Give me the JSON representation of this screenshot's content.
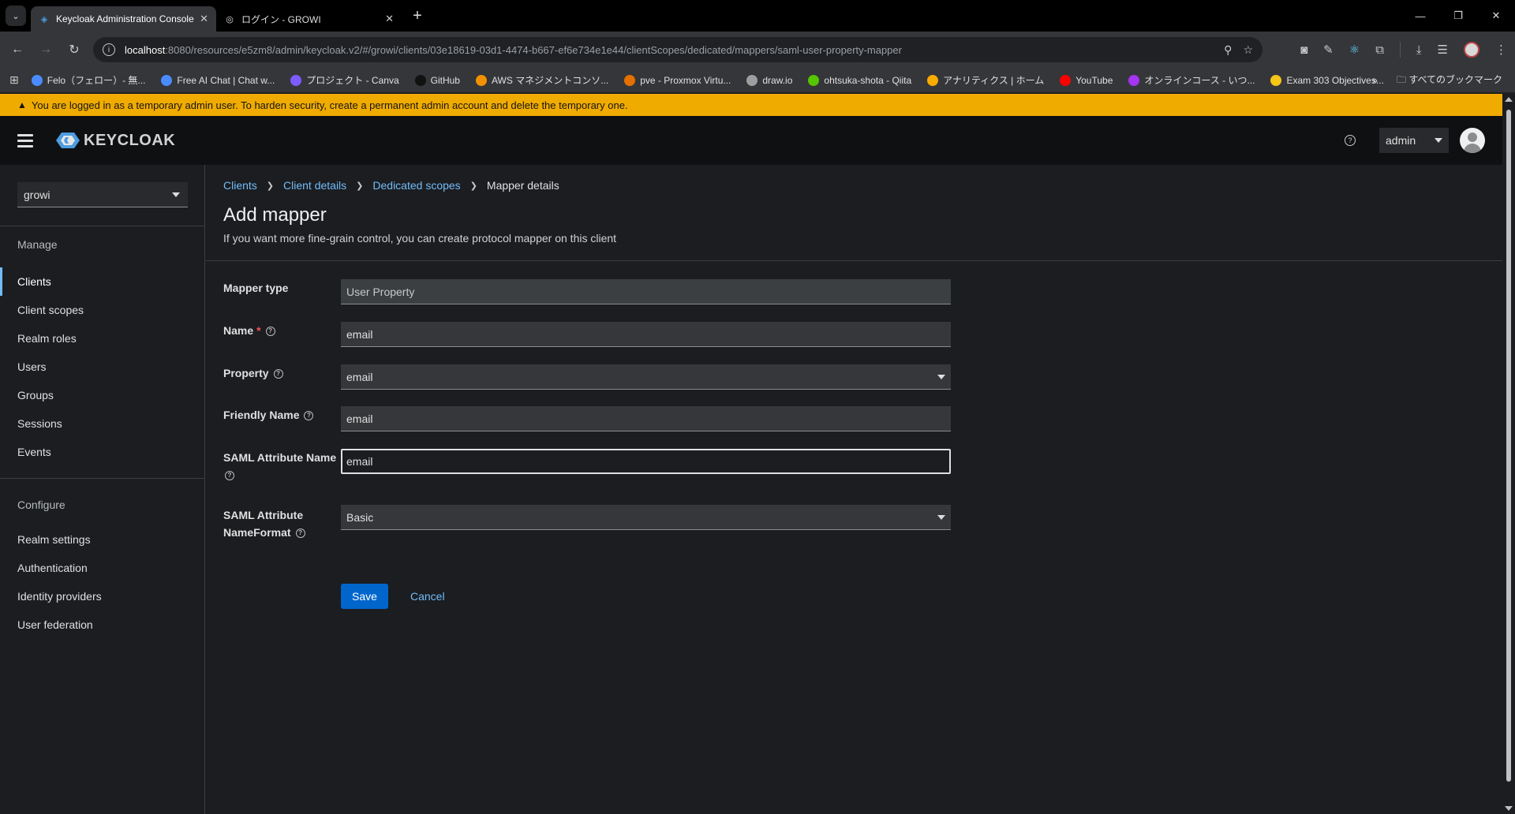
{
  "browser": {
    "tabs": [
      {
        "title": "Keycloak Administration Console",
        "icon": "keycloak-icon",
        "active": true
      },
      {
        "title": "ログイン - GROWI",
        "icon": "globe-icon",
        "active": false
      }
    ],
    "url_host": "localhost",
    "url_rest": ":8080/resources/e5zm8/admin/keycloak.v2/#/growi/clients/03e18619-03d1-4474-b667-ef6e734e1e44/clientScopes/dedicated/mappers/saml-user-property-mapper",
    "bookmarks": [
      {
        "label": "Felo（フェロー）- 無...",
        "color": "#4a8cff"
      },
      {
        "label": "Free AI Chat | Chat w...",
        "color": "#4a8cff"
      },
      {
        "label": "プロジェクト - Canva",
        "color": "#7d5cff"
      },
      {
        "label": "GitHub",
        "color": "#111111"
      },
      {
        "label": "AWS マネジメントコンソ...",
        "color": "#f29100"
      },
      {
        "label": "pve - Proxmox Virtu...",
        "color": "#e57000"
      },
      {
        "label": "draw.io",
        "color": "#9e9e9e"
      },
      {
        "label": "ohtsuka-shota - Qiita",
        "color": "#55c500"
      },
      {
        "label": "アナリティクス | ホーム",
        "color": "#f9ab00"
      },
      {
        "label": "YouTube",
        "color": "#ff0000"
      },
      {
        "label": "オンラインコース - いつ...",
        "color": "#a435f0"
      },
      {
        "label": "Exam 303 Objectives...",
        "color": "#f5c518"
      }
    ],
    "all_bookmarks_label": "すべてのブックマーク"
  },
  "banner": {
    "text": "You are logged in as a temporary admin user. To harden security, create a permanent admin account and delete the temporary one."
  },
  "header": {
    "logo_text": "KEYCLOAK",
    "user_label": "admin"
  },
  "sidebar": {
    "realm": "growi",
    "manage_title": "Manage",
    "manage_items": [
      "Clients",
      "Client scopes",
      "Realm roles",
      "Users",
      "Groups",
      "Sessions",
      "Events"
    ],
    "configure_title": "Configure",
    "configure_items": [
      "Realm settings",
      "Authentication",
      "Identity providers",
      "User federation"
    ]
  },
  "breadcrumb": {
    "items": [
      "Clients",
      "Client details",
      "Dedicated scopes"
    ],
    "current": "Mapper details"
  },
  "page": {
    "title": "Add mapper",
    "description": "If you want more fine-grain control, you can create protocol mapper on this client"
  },
  "form": {
    "mapper_type": {
      "label": "Mapper type",
      "value": "User Property"
    },
    "name": {
      "label": "Name",
      "required_mark": "*",
      "value": "email"
    },
    "property": {
      "label": "Property",
      "value": "email"
    },
    "friendly_name": {
      "label": "Friendly Name",
      "value": "email"
    },
    "saml_attribute_name": {
      "label": "SAML Attribute Name",
      "value": "email"
    },
    "saml_name_format": {
      "label_line1": "SAML Attribute",
      "label_line2": "NameFormat",
      "value": "Basic"
    },
    "save_label": "Save",
    "cancel_label": "Cancel"
  }
}
